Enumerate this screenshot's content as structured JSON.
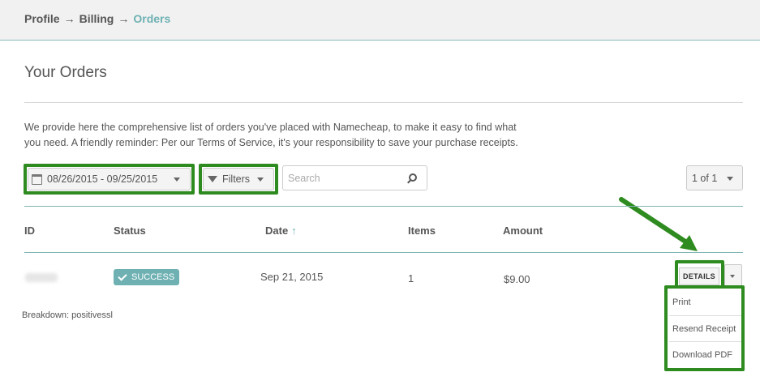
{
  "breadcrumb": {
    "items": [
      "Profile",
      "Billing"
    ],
    "current": "Orders",
    "separator": "→"
  },
  "page": {
    "title": "Your Orders",
    "intro_line1": "We provide here the comprehensive list of orders you've placed with Namecheap, to make it easy to find what",
    "intro_line2": "you need. A friendly reminder: Per our Terms of Service, it's your responsibility to save your purchase receipts."
  },
  "toolbar": {
    "date_range": "08/26/2015 - 09/25/2015",
    "filters_label": "Filters",
    "search_placeholder": "Search",
    "search_value": "",
    "pager_label": "1 of 1"
  },
  "table": {
    "columns": [
      "ID",
      "Status",
      "Date",
      "Items",
      "Amount"
    ],
    "sort_indicator": "↑",
    "rows": [
      {
        "id": "",
        "status": "SUCCESS",
        "date": "Sep 21, 2015",
        "items": "1",
        "amount": "$9.00"
      }
    ],
    "breakdown": "Breakdown: positivessl"
  },
  "details": {
    "button_label": "DETAILS",
    "menu_items": [
      "Print",
      "Resend Receipt",
      "Download PDF"
    ]
  },
  "colors": {
    "accent": "#6fb1b3",
    "highlight": "#2e8b1f",
    "badge": "#6fb1b3"
  }
}
